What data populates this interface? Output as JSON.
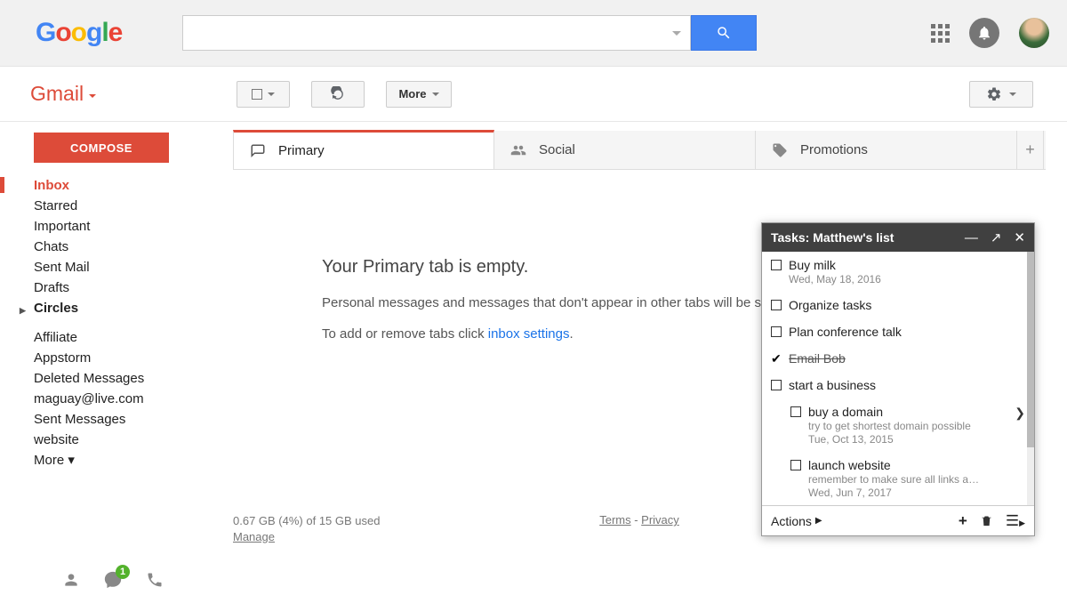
{
  "header": {
    "logo": [
      "G",
      "o",
      "o",
      "g",
      "l",
      "e"
    ],
    "search_value": "",
    "search_placeholder": ""
  },
  "brand": {
    "name": "Gmail"
  },
  "toolbar": {
    "more_label": "More"
  },
  "sidebar": {
    "compose_label": "COMPOSE",
    "items": [
      {
        "label": "Inbox",
        "cls": "inbox"
      },
      {
        "label": "Starred"
      },
      {
        "label": "Important"
      },
      {
        "label": "Chats"
      },
      {
        "label": "Sent Mail"
      },
      {
        "label": "Drafts"
      },
      {
        "label": "Circles",
        "cls": "bold circ"
      },
      {
        "sep": true
      },
      {
        "label": "Affiliate"
      },
      {
        "label": "Appstorm"
      },
      {
        "label": "Deleted Messages"
      },
      {
        "label": "maguay@live.com"
      },
      {
        "label": "Sent Messages"
      },
      {
        "label": "website"
      },
      {
        "label": "More ▾"
      }
    ],
    "hangouts_badge": "1"
  },
  "tabs": {
    "primary": "Primary",
    "social": "Social",
    "promotions": "Promotions"
  },
  "empty_state": {
    "title": "Your Primary tab is empty.",
    "line1": "Personal messages and messages that don't appear in other tabs will be shown here.",
    "line2_pre": "To add or remove tabs click ",
    "link": "inbox settings",
    "line2_post": "."
  },
  "footer": {
    "storage_line": "0.67 GB (4%) of 15 GB used",
    "manage": "Manage",
    "terms": "Terms",
    "privacy": "Privacy"
  },
  "tasks": {
    "title": "Tasks: Matthew's list",
    "items": [
      {
        "title": "Buy milk",
        "date": "Wed, May 18, 2016"
      },
      {
        "title": "Organize tasks"
      },
      {
        "title": "Plan conference talk"
      },
      {
        "title": "Email Bob",
        "done": true
      },
      {
        "title": "start a business"
      },
      {
        "title": "buy a domain",
        "note": "try to get shortest domain possible",
        "date": "Tue, Oct 13, 2015",
        "sub": true,
        "arrow": true
      },
      {
        "title": "launch website",
        "note": "remember to make sure all links a…",
        "date": "Wed, Jun 7, 2017",
        "sub": true
      }
    ],
    "actions_label": "Actions"
  }
}
